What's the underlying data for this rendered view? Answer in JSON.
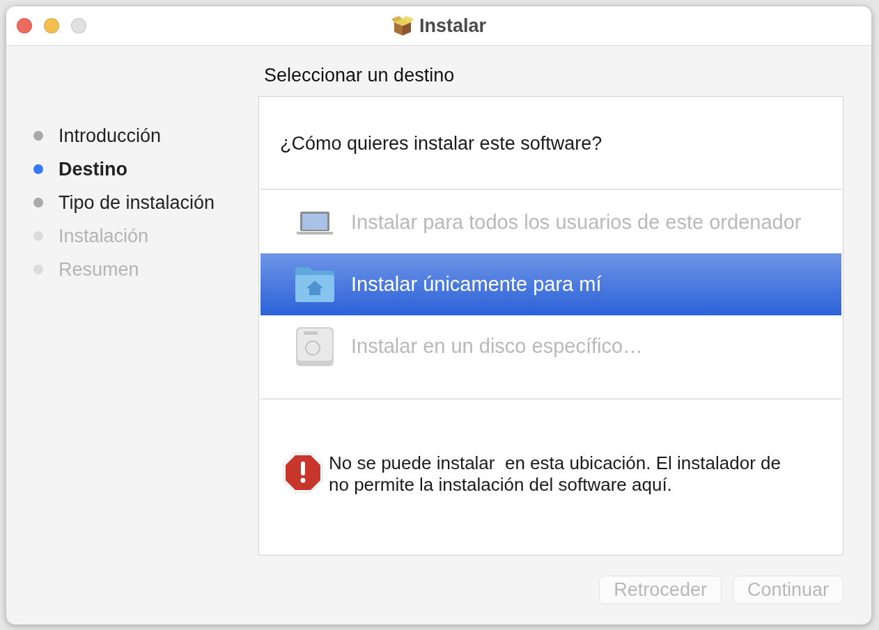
{
  "window": {
    "title": "Instalar",
    "controls": [
      {
        "kind": "close",
        "disabled": false
      },
      {
        "kind": "minimize",
        "disabled": false
      },
      {
        "kind": "zoom",
        "disabled": true
      }
    ]
  },
  "steps": [
    {
      "label": "Introducción",
      "selected": false,
      "disabled": false
    },
    {
      "label": "Destino",
      "selected": true,
      "disabled": false
    },
    {
      "label": "Tipo de instalación",
      "selected": false,
      "disabled": false
    },
    {
      "label": "Instalación",
      "selected": false,
      "disabled": true
    },
    {
      "label": "Resumen",
      "selected": false,
      "disabled": true
    }
  ],
  "heading": "Seleccionar un destino",
  "question": "¿Cómo quieres instalar este software?",
  "options": [
    {
      "kind": "laptop",
      "label": "Instalar para todos los usuarios de este ordenador",
      "disabled": true,
      "selected": false
    },
    {
      "kind": "home",
      "label": "Instalar únicamente para mí",
      "disabled": false,
      "selected": true
    },
    {
      "kind": "disk",
      "label": "Instalar en un disco específico…",
      "disabled": true,
      "selected": false
    }
  ],
  "message": "No se puede instalar  en esta ubicación. El instalador de no permite la instalación del software aquí.",
  "buttons": [
    {
      "label": "Retroceder",
      "disabled": true
    },
    {
      "label": "Continuar",
      "disabled": true
    }
  ]
}
